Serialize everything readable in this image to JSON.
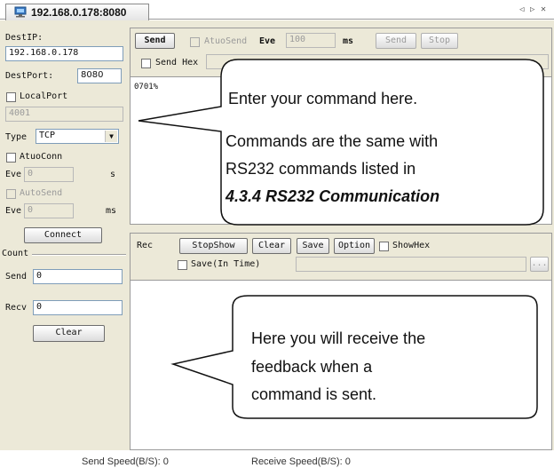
{
  "tabbar": {
    "tab_title": "192.168.0.178:8080",
    "nav_left": "◁",
    "nav_right": "▷",
    "close": "✕"
  },
  "left": {
    "destip_label": "DestIP:",
    "destip_value": "192.168.0.178",
    "destport_label": "DestPort:",
    "destport_value": "8080",
    "localport_label": "LocalPort",
    "localport_value": "4001",
    "type_label": "Type",
    "type_value": "TCP",
    "atuoconn_label": "AtuoConn",
    "eve1_label": "Eve",
    "eve1_value": "0",
    "eve1_unit": "s",
    "autosend_label": "AutoSend",
    "eve2_label": "Eve",
    "eve2_value": "0",
    "eve2_unit": "ms",
    "connect_button": "Connect",
    "count_label": "Count",
    "send_label": "Send",
    "send_value": "0",
    "recv_label": "Recv",
    "recv_value": "0",
    "clear_button": "Clear"
  },
  "send_section": {
    "send_button": "Send",
    "atuosend_label": "AtuoSend",
    "eve_label": "Eve",
    "eve_value": "100",
    "ms_label": "ms",
    "send_disabled_button": "Send",
    "stop_button": "Stop",
    "sendhex_label": "Send Hex",
    "text": "0701%"
  },
  "rec_section": {
    "rec_label": "Rec",
    "stopshow_button": "StopShow",
    "clear_button": "Clear",
    "save_button": "Save",
    "option_button": "Option",
    "showhex_label": "ShowHex",
    "save_intime_label": "Save(In Time)",
    "browse_button": "..."
  },
  "callout_send": {
    "line1": "Enter your command here.",
    "line2": "Commands are the same with",
    "line3": "RS232 commands listed in",
    "line4": "4.3.4 RS232 Communication"
  },
  "callout_recv": {
    "line1": "Here you will receive the",
    "line2": "feedback when a",
    "line3": "command is sent."
  },
  "statusbar": {
    "send_speed": "Send Speed(B/S): 0",
    "receive_speed": "Receive Speed(B/S): 0"
  },
  "colors": {
    "window_bg": "#ece9d8",
    "pane_bg": "#ffffff",
    "input_border": "#7f9db9"
  }
}
